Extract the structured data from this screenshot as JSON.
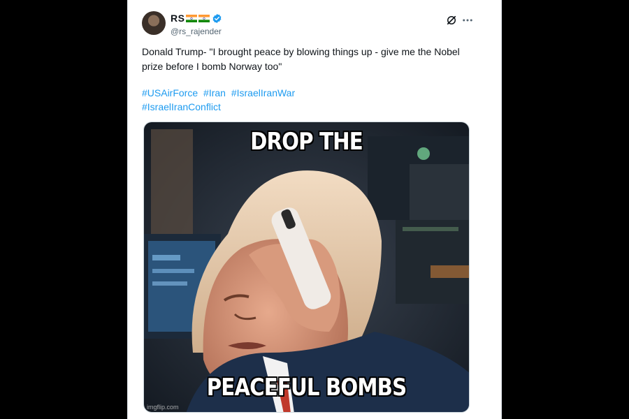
{
  "tweet": {
    "display_name": "RS",
    "handle": "@rs_rajender",
    "text": "Donald Trump- \"I brought peace by blowing things up - give me the Nobel prize before I bomb Norway too\"",
    "hashtags": [
      "#USAirForce",
      "#Iran",
      "#IsraelIranWar",
      "#IsraelIranConflict"
    ],
    "icons": {
      "avatar": "profile-photo",
      "flags": [
        "india-flag-icon",
        "india-flag-icon"
      ],
      "verified": "verified-badge-icon",
      "grok": "grok-icon",
      "more": "more-options-icon"
    },
    "colors": {
      "link": "#1d9bf0",
      "verified": "#1d9bf0"
    }
  },
  "meme": {
    "top_text": "DROP THE",
    "bottom_text": "PEACEFUL BOMBS",
    "watermark": "imgflip.com"
  }
}
